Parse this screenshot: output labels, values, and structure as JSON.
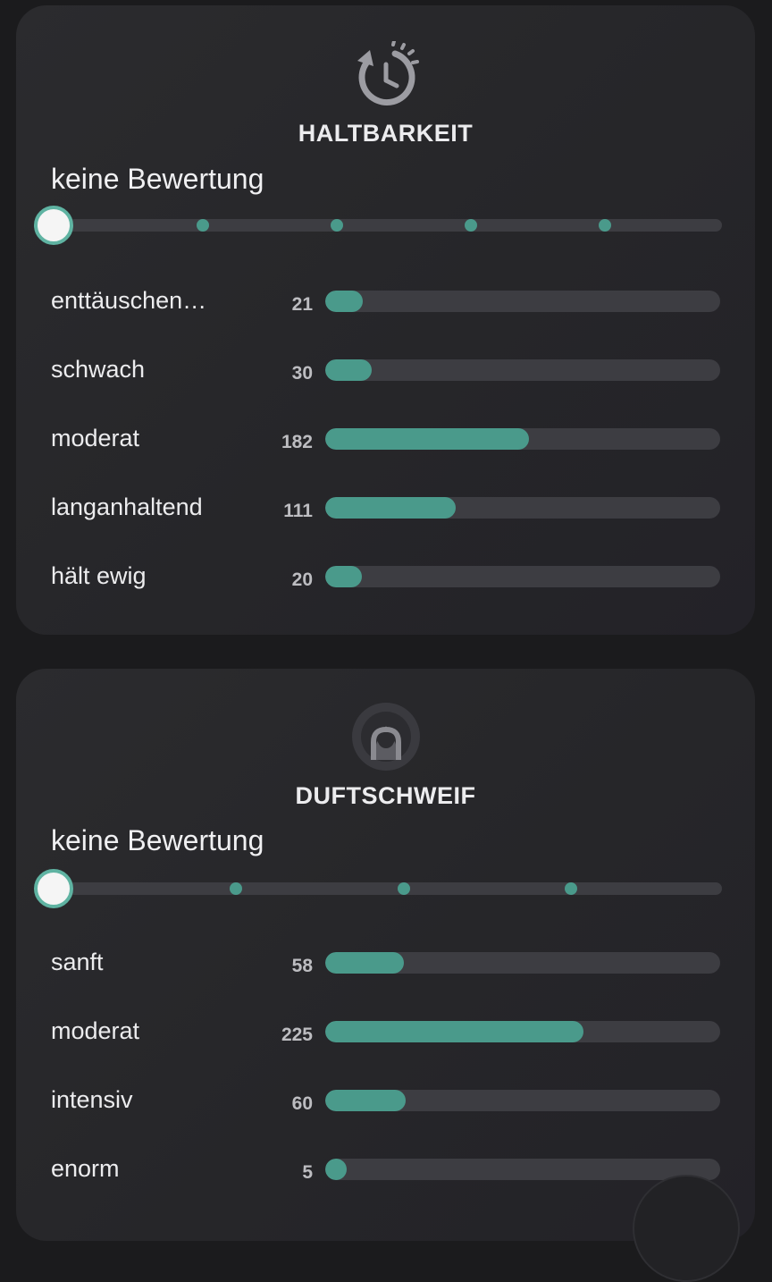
{
  "sections": [
    {
      "title": "HALTBARKEIT",
      "icon": "clock-history-icon",
      "rating_label": "keine Bewertung",
      "slider_steps": 6,
      "slider_value": 0,
      "max_count": 182,
      "rows": [
        {
          "label": "enttäuschen…",
          "count": "21",
          "value": 21
        },
        {
          "label": "schwach",
          "count": "30",
          "value": 30
        },
        {
          "label": "moderat",
          "count": "182",
          "value": 182
        },
        {
          "label": "langanhaltend",
          "count": "111",
          "value": 111
        },
        {
          "label": "hält ewig",
          "count": "20",
          "value": 20
        }
      ]
    },
    {
      "title": "DUFTSCHWEIF",
      "icon": "sillage-person-icon",
      "rating_label": "keine Bewertung",
      "slider_steps": 5,
      "slider_value": 0,
      "max_count": 225,
      "rows": [
        {
          "label": "sanft",
          "count": "58",
          "value": 58
        },
        {
          "label": "moderat",
          "count": "225",
          "value": 225
        },
        {
          "label": "intensiv",
          "count": "60",
          "value": 60
        },
        {
          "label": "enorm",
          "count": "5",
          "value": 5
        }
      ]
    }
  ],
  "colors": {
    "accent": "#4a9a8b",
    "track": "#3d3d42",
    "card": "#2a2a2d",
    "background": "#1b1b1d"
  }
}
